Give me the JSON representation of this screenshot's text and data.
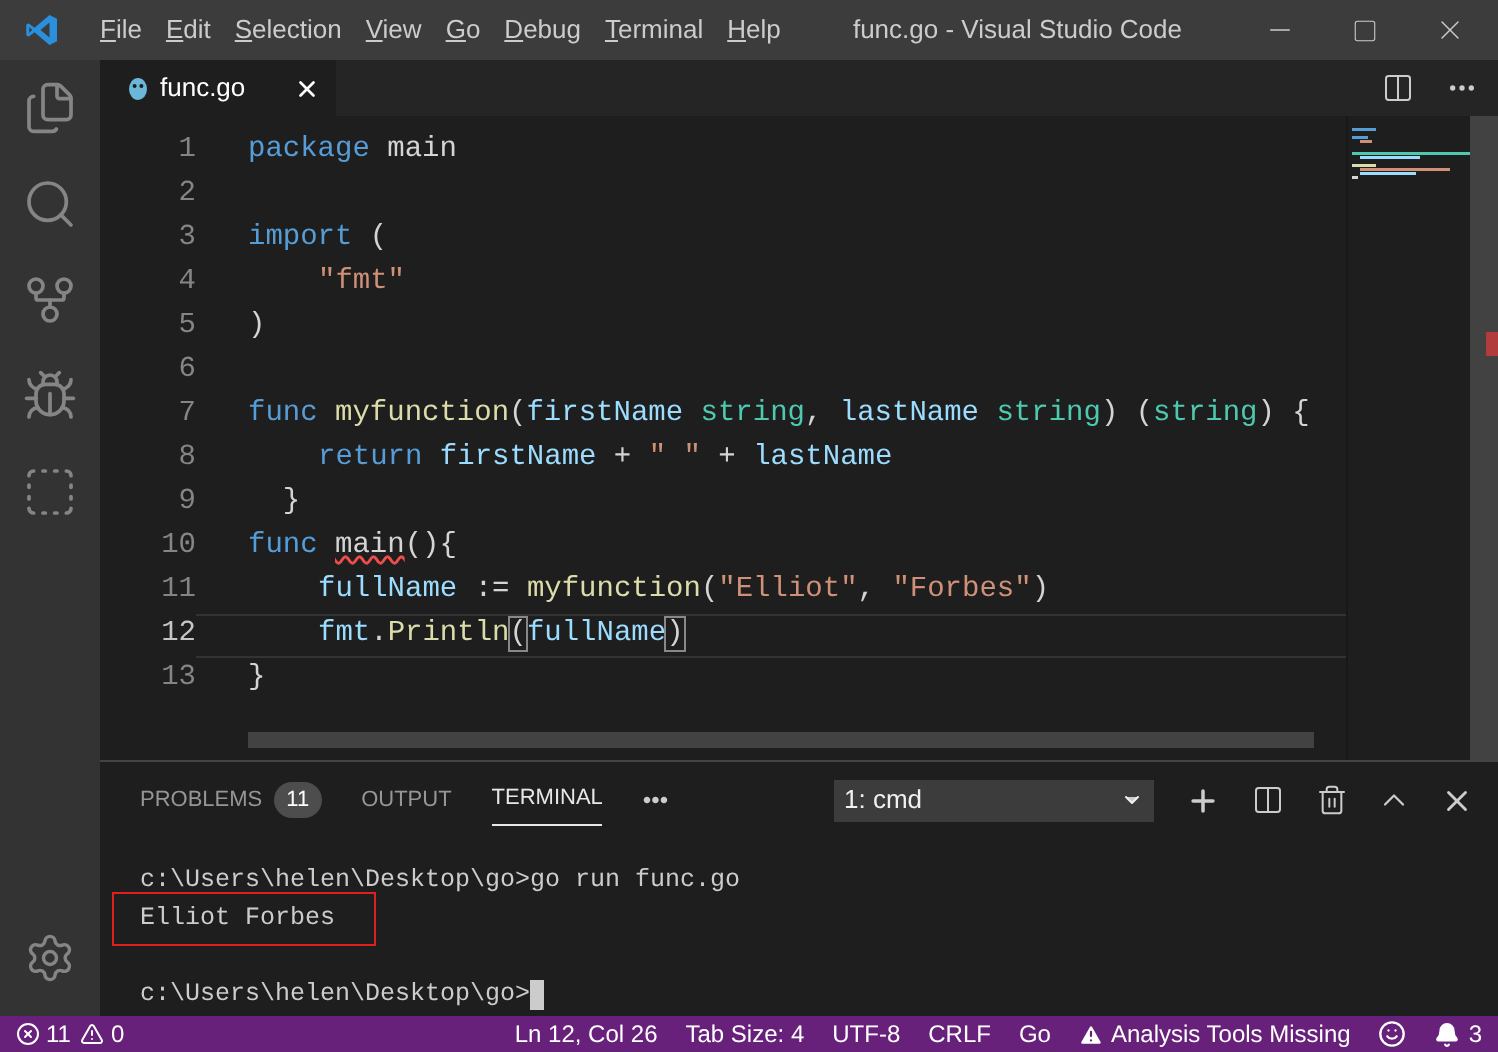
{
  "window": {
    "title": "func.go - Visual Studio Code"
  },
  "menu": [
    "File",
    "Edit",
    "Selection",
    "View",
    "Go",
    "Debug",
    "Terminal",
    "Help"
  ],
  "activity_bar": [
    {
      "kind": "files",
      "selected": false
    },
    {
      "kind": "search",
      "selected": false
    },
    {
      "kind": "scm",
      "selected": false
    },
    {
      "kind": "debug",
      "selected": false
    },
    {
      "kind": "extensions",
      "selected": false
    }
  ],
  "tabs": [
    {
      "label": "func.go",
      "selected": true
    }
  ],
  "editor": {
    "lines": [
      {
        "number": "1",
        "current": false,
        "tokens": [
          {
            "kind": "keyword",
            "text": "package"
          },
          {
            "kind": "plain",
            "text": " main"
          }
        ]
      },
      {
        "number": "2",
        "current": false
      },
      {
        "number": "3",
        "current": false,
        "tokens": [
          {
            "kind": "keyword",
            "text": "import"
          },
          {
            "kind": "plain",
            "text": " ("
          }
        ]
      },
      {
        "number": "4",
        "current": false,
        "indented": true,
        "tokens": [
          {
            "kind": "string",
            "text": "\"fmt\""
          }
        ]
      },
      {
        "number": "5",
        "current": false,
        "tokens": [
          {
            "kind": "plain",
            "text": ")"
          }
        ]
      },
      {
        "number": "6",
        "current": false
      },
      {
        "number": "7",
        "current": false,
        "tokens": [
          {
            "kind": "keyword",
            "text": "func"
          },
          {
            "kind": "function",
            "text": " myfunction"
          },
          {
            "kind": "plain",
            "text": "("
          },
          {
            "kind": "param",
            "text": "firstName"
          },
          {
            "kind": "type",
            "text": " string"
          },
          {
            "kind": "plain",
            "text": ", "
          },
          {
            "kind": "param",
            "text": "lastName"
          },
          {
            "kind": "type",
            "text": " string"
          },
          {
            "kind": "plain",
            "text": ") ("
          },
          {
            "kind": "type",
            "text": "string"
          },
          {
            "kind": "plain",
            "text": ") {"
          }
        ]
      },
      {
        "number": "8",
        "current": false,
        "indented": true,
        "tokens": [
          {
            "kind": "keyword",
            "text": "return"
          },
          {
            "kind": "param",
            "text": " firstName"
          },
          {
            "kind": "plain",
            "text": " + "
          },
          {
            "kind": "string",
            "text": "\" \""
          },
          {
            "kind": "plain",
            "text": " + "
          },
          {
            "kind": "param",
            "text": "lastName"
          }
        ]
      },
      {
        "number": "9",
        "current": false,
        "tokens": [
          {
            "kind": "plain",
            "text": "  }"
          }
        ]
      },
      {
        "number": "10",
        "current": false,
        "tokens": [
          {
            "kind": "keyword",
            "text": "func "
          },
          {
            "kind": "error",
            "text": "main"
          },
          {
            "kind": "plain",
            "text": "(){"
          }
        ]
      },
      {
        "number": "11",
        "current": false,
        "indented": true,
        "tokens": [
          {
            "kind": "param",
            "text": "fullName"
          },
          {
            "kind": "plain",
            "text": " := "
          },
          {
            "kind": "function",
            "text": "myfunction"
          },
          {
            "kind": "plain",
            "text": "("
          },
          {
            "kind": "string",
            "text": "\"Elliot\""
          },
          {
            "kind": "plain",
            "text": ", "
          },
          {
            "kind": "string",
            "text": "\"Forbes\""
          },
          {
            "kind": "plain",
            "text": ")"
          }
        ]
      },
      {
        "number": "12",
        "current": true,
        "indented": true,
        "tokens": [
          {
            "kind": "param",
            "text": "fmt"
          },
          {
            "kind": "plain",
            "text": "."
          },
          {
            "kind": "function",
            "text": "Println"
          },
          {
            "kind": "bracket",
            "text": "("
          },
          {
            "kind": "param",
            "text": "fullName"
          },
          {
            "kind": "bracket",
            "text": ")"
          }
        ]
      },
      {
        "number": "13",
        "current": false,
        "tokens": [
          {
            "kind": "plain",
            "text": "}"
          }
        ]
      }
    ]
  },
  "panel": {
    "tabs": [
      {
        "label": "PROBLEMS",
        "badge": "11",
        "selected": false
      },
      {
        "label": "OUTPUT",
        "selected": false
      },
      {
        "label": "TERMINAL",
        "selected": true
      }
    ],
    "more": "•••",
    "terminal_select": "1: cmd",
    "terminal_lines": [
      {
        "kind": "text",
        "text": "c:\\Users\\helen\\Desktop\\go>go run func.go"
      },
      {
        "kind": "text",
        "text": "Elliot Forbes",
        "highlighted": true
      },
      {
        "kind": "blank"
      },
      {
        "kind": "text",
        "text": "c:\\Users\\helen\\Desktop\\go>",
        "cursor": true
      }
    ]
  },
  "status_bar": {
    "errors": "11",
    "warnings": "0",
    "items": [
      "Ln 12, Col 26",
      "Tab Size: 4",
      "UTF-8",
      "CRLF",
      "Go"
    ],
    "analysis": "Analysis Tools Missing",
    "notifications": "3"
  }
}
